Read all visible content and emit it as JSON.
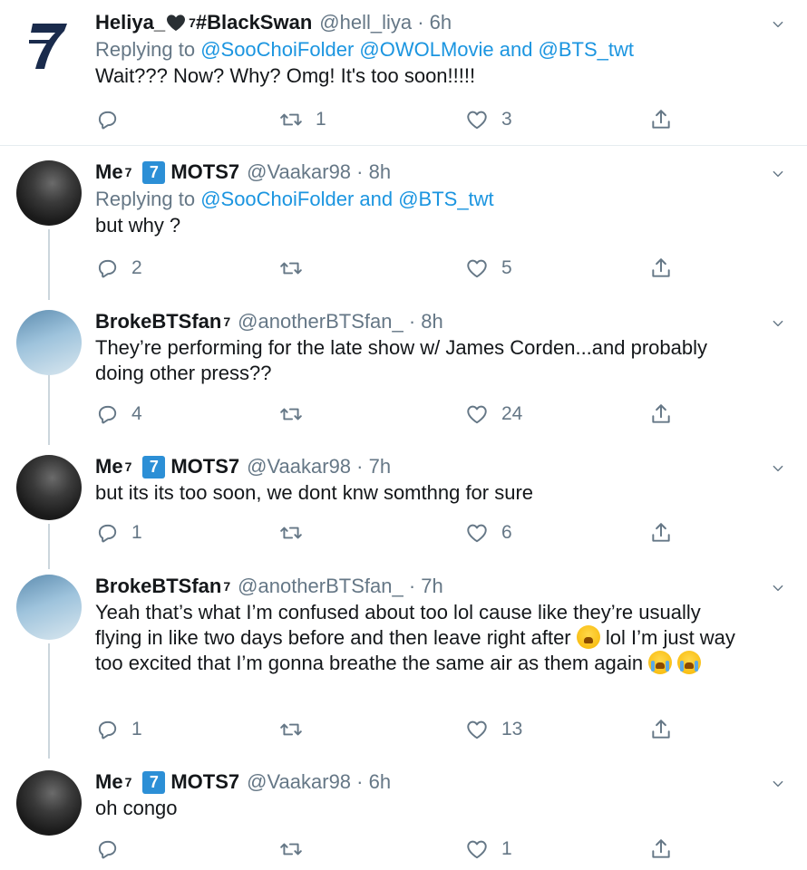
{
  "tweets": [
    {
      "avatar": "bts-7-logo",
      "name": "Heliya_",
      "name_emoji": "black-heart",
      "name_sup": "7",
      "name_suffix": " #BlackSwan",
      "handle": "@hell_liya · 6h",
      "reply_prefix": "Replying to ",
      "reply_mentions": "@SooChoiFolder @OWOLMovie and @BTS_twt",
      "text": "Wait??? Now? Why? Omg! It's too soon!!!!!",
      "reply_count": "",
      "retweet_count": "1",
      "like_count": "3"
    },
    {
      "avatar": "me-avatar",
      "name": "Me",
      "name_sup": "7",
      "badge": "7",
      "name_suffix": "MOTS7",
      "handle": "@Vaakar98 · 8h",
      "reply_prefix": "Replying to ",
      "reply_mentions": "@SooChoiFolder and @BTS_twt",
      "text": "but why ?",
      "reply_count": "2",
      "retweet_count": "",
      "like_count": "5"
    },
    {
      "avatar": "broke-avatar",
      "name": "BrokeBTSfan",
      "name_sup": "7",
      "handle": "@anotherBTSfan_ · 8h",
      "text": "They’re performing for the late show w/ James Corden...and probably doing other press??",
      "reply_count": "4",
      "retweet_count": "",
      "like_count": "24"
    },
    {
      "avatar": "me-avatar",
      "name": "Me",
      "name_sup": "7",
      "badge": "7",
      "name_suffix": "MOTS7",
      "handle": "@Vaakar98 · 7h",
      "text": "but its its too soon, we dont knw somthng for sure",
      "reply_count": "1",
      "retweet_count": "",
      "like_count": "6"
    },
    {
      "avatar": "broke-avatar",
      "name": "BrokeBTSfan",
      "name_sup": "7",
      "handle": "@anotherBTSfan_ · 7h",
      "text_1": "Yeah that’s what I’m confused about too lol cause like they’re usually flying in like two days before and then leave right after",
      "text_2": " lol I’m just way too excited that I’m gonna breathe the same air as them again",
      "emoji_1": "weary-face",
      "emoji_2": "loudly-crying-face",
      "reply_count": "1",
      "retweet_count": "",
      "like_count": "13"
    },
    {
      "avatar": "me-avatar",
      "name": "Me",
      "name_sup": "7",
      "badge": "7",
      "name_suffix": "MOTS7",
      "handle": "@Vaakar98 · 6h",
      "text": "oh congo",
      "reply_count": "",
      "retweet_count": "",
      "like_count": "1"
    }
  ],
  "colors": {
    "text": "#14171a",
    "muted": "#657786",
    "link": "#1b95e0",
    "badge": "#2c8fd6",
    "thread_line": "#ccd6dd"
  }
}
